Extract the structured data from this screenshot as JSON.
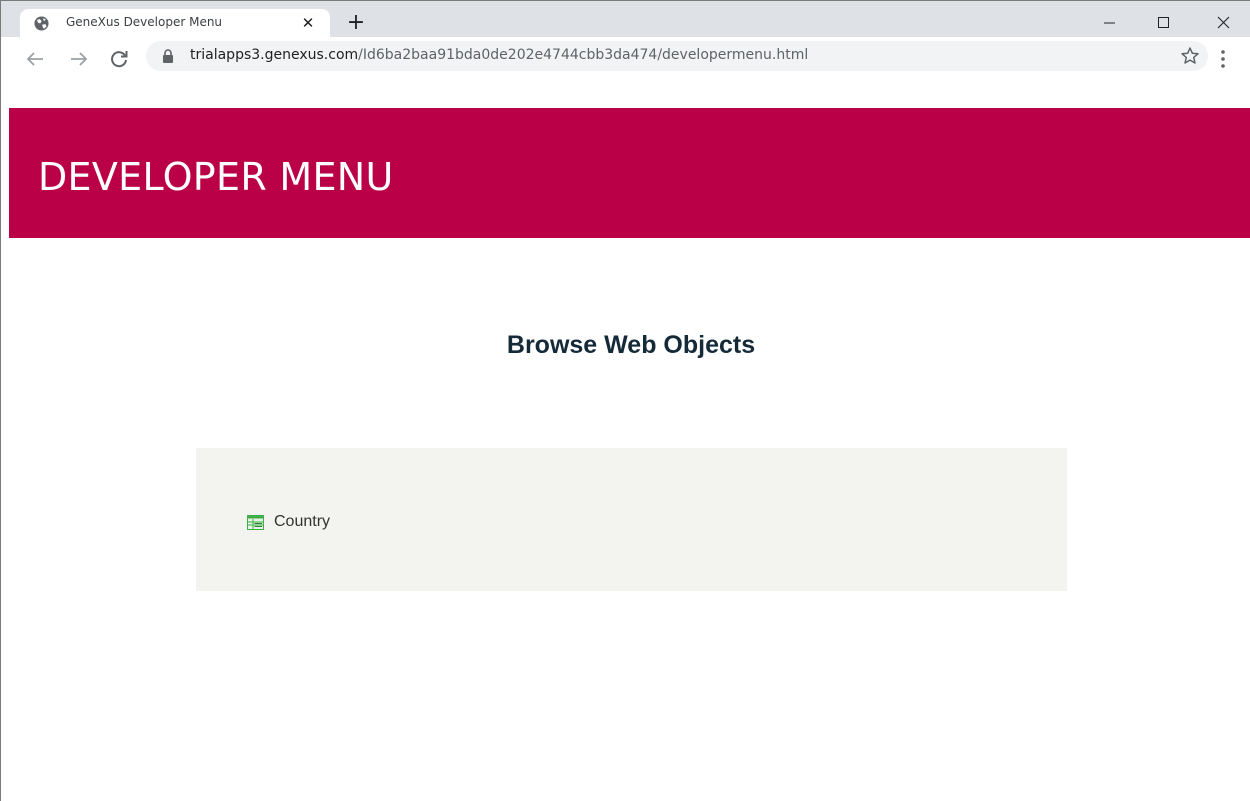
{
  "browser": {
    "tab": {
      "title": "GeneXus Developer Menu",
      "close_glyph": "✕",
      "favicon": "globe-icon"
    },
    "new_tab_glyph": "+",
    "window_controls": [
      "minimize-icon",
      "maximize-icon",
      "close-icon"
    ],
    "nav": [
      "back-arrow-icon",
      "forward-arrow-icon",
      "reload-icon"
    ],
    "address": {
      "host": "trialapps3.genexus.com",
      "path": "/Id6ba2baa91bda0de202e4744cbb3da474/developermenu.html"
    }
  },
  "page": {
    "header_title": "DEVELOPER MENU",
    "section_heading": "Browse Web Objects",
    "objects": [
      {
        "label": "Country",
        "icon": "grid-icon"
      }
    ]
  },
  "colors": {
    "header_bg": "#ba0046",
    "panel_bg": "#f3f4f0",
    "heading_text": "#152a39",
    "tabstrip_bg": "#dee1e6",
    "icon_green": "#3fae49"
  }
}
